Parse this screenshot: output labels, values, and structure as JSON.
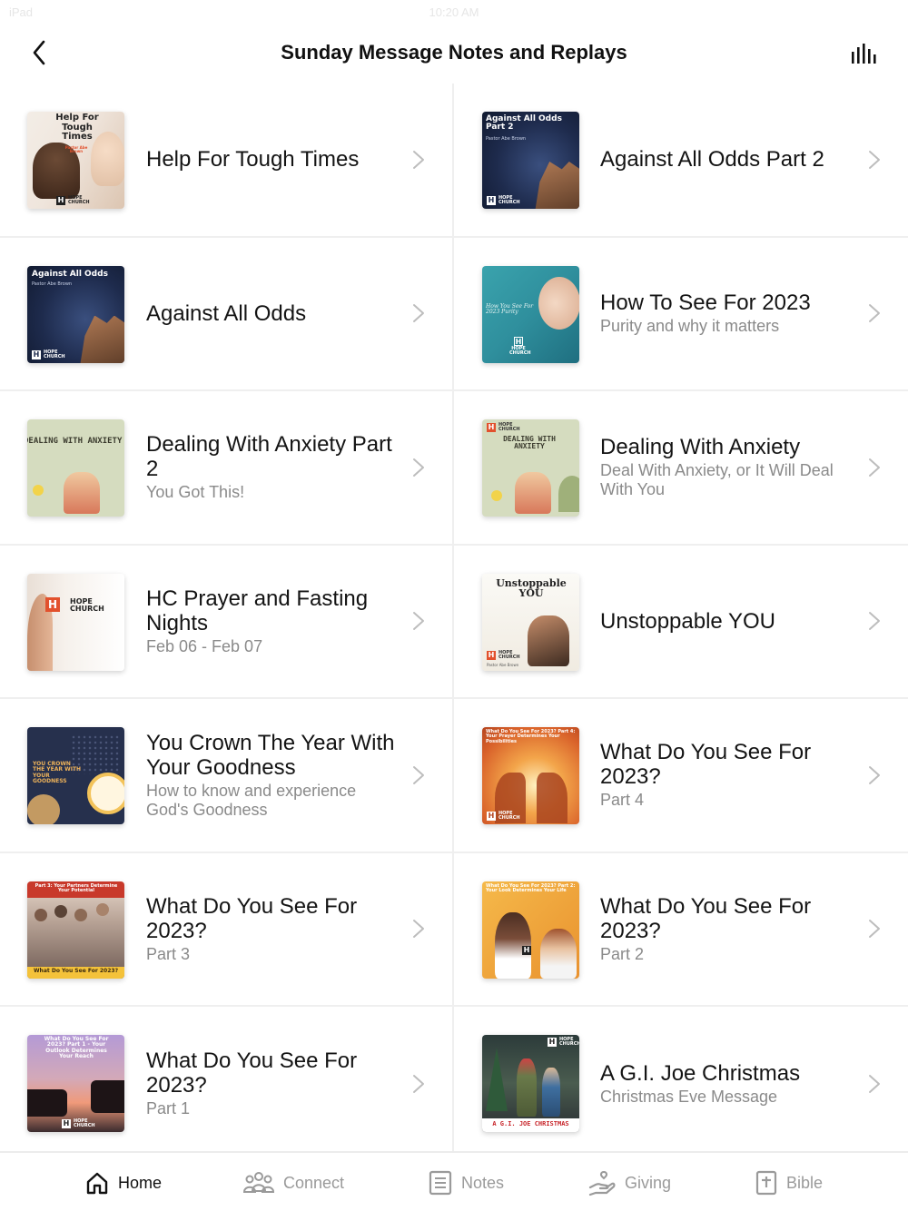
{
  "status_bar": {
    "carrier": "iPad",
    "time": "10:20 AM"
  },
  "nav": {
    "title": "Sunday Message Notes and Replays"
  },
  "thumbs": {
    "help": "Help For Tough Times",
    "help_sub": "Pastor Abe Brown",
    "aao2": "Against All Odds Part 2",
    "aao": "Against All Odds",
    "pastor": "Pastor Abe Brown",
    "htsf": "How You See For 2023 Purity",
    "anx": "DEALING WITH ANXIETY",
    "hc_big": "HOPE CHURCH",
    "unstoppable": "Unstoppable YOU",
    "crown": "YOU CROWN THE YEAR WITH YOUR GOODNESS",
    "wdys4": "What Do You See For 2023? Part 4: Your Prayer Determines Your Possibilities",
    "wdys3_top": "Part 3: Your Partners Determine Your Potential",
    "wdys3_bottom": "What Do You See For 2023?",
    "wdys2": "What Do You See For 2023? Part 2: Your Look Determines Your Life",
    "wdys1": "What Do You See For 2023? Part 1 - Your Outlook Determines Your Reach",
    "gijoe": "A G.I. JOE CHRISTMAS",
    "logo": "HOPE CHURCH"
  },
  "items": [
    {
      "title": "Help For Tough Times",
      "subtitle": ""
    },
    {
      "title": "Against All Odds Part 2",
      "subtitle": ""
    },
    {
      "title": "Against All Odds",
      "subtitle": ""
    },
    {
      "title": "How To See For 2023",
      "subtitle": "Purity and why it matters"
    },
    {
      "title": "Dealing With Anxiety Part 2",
      "subtitle": "You Got This!"
    },
    {
      "title": "Dealing With Anxiety",
      "subtitle": "Deal With Anxiety, or It Will Deal With You"
    },
    {
      "title": "HC Prayer and Fasting Nights",
      "subtitle": "Feb 06 - Feb 07"
    },
    {
      "title": "Unstoppable YOU",
      "subtitle": ""
    },
    {
      "title": "You Crown The Year With Your Goodness",
      "subtitle": "How to know and experience God's Goodness"
    },
    {
      "title": "What Do You See For 2023?",
      "subtitle": "Part 4"
    },
    {
      "title": "What Do You See For 2023?",
      "subtitle": "Part 3"
    },
    {
      "title": "What Do You See For 2023?",
      "subtitle": "Part 2"
    },
    {
      "title": "What Do You See For 2023?",
      "subtitle": "Part 1"
    },
    {
      "title": "A G.I. Joe Christmas",
      "subtitle": "Christmas Eve Message"
    }
  ],
  "tabs": [
    {
      "label": "Home",
      "icon": "home-icon"
    },
    {
      "label": "Connect",
      "icon": "people-icon"
    },
    {
      "label": "Notes",
      "icon": "notes-icon"
    },
    {
      "label": "Giving",
      "icon": "giving-icon"
    },
    {
      "label": "Bible",
      "icon": "bible-icon"
    }
  ],
  "colors": {
    "accent": "#111111",
    "inactive": "#9a9a9a",
    "divider": "#efefef",
    "brand_orange": "#e2512d"
  }
}
